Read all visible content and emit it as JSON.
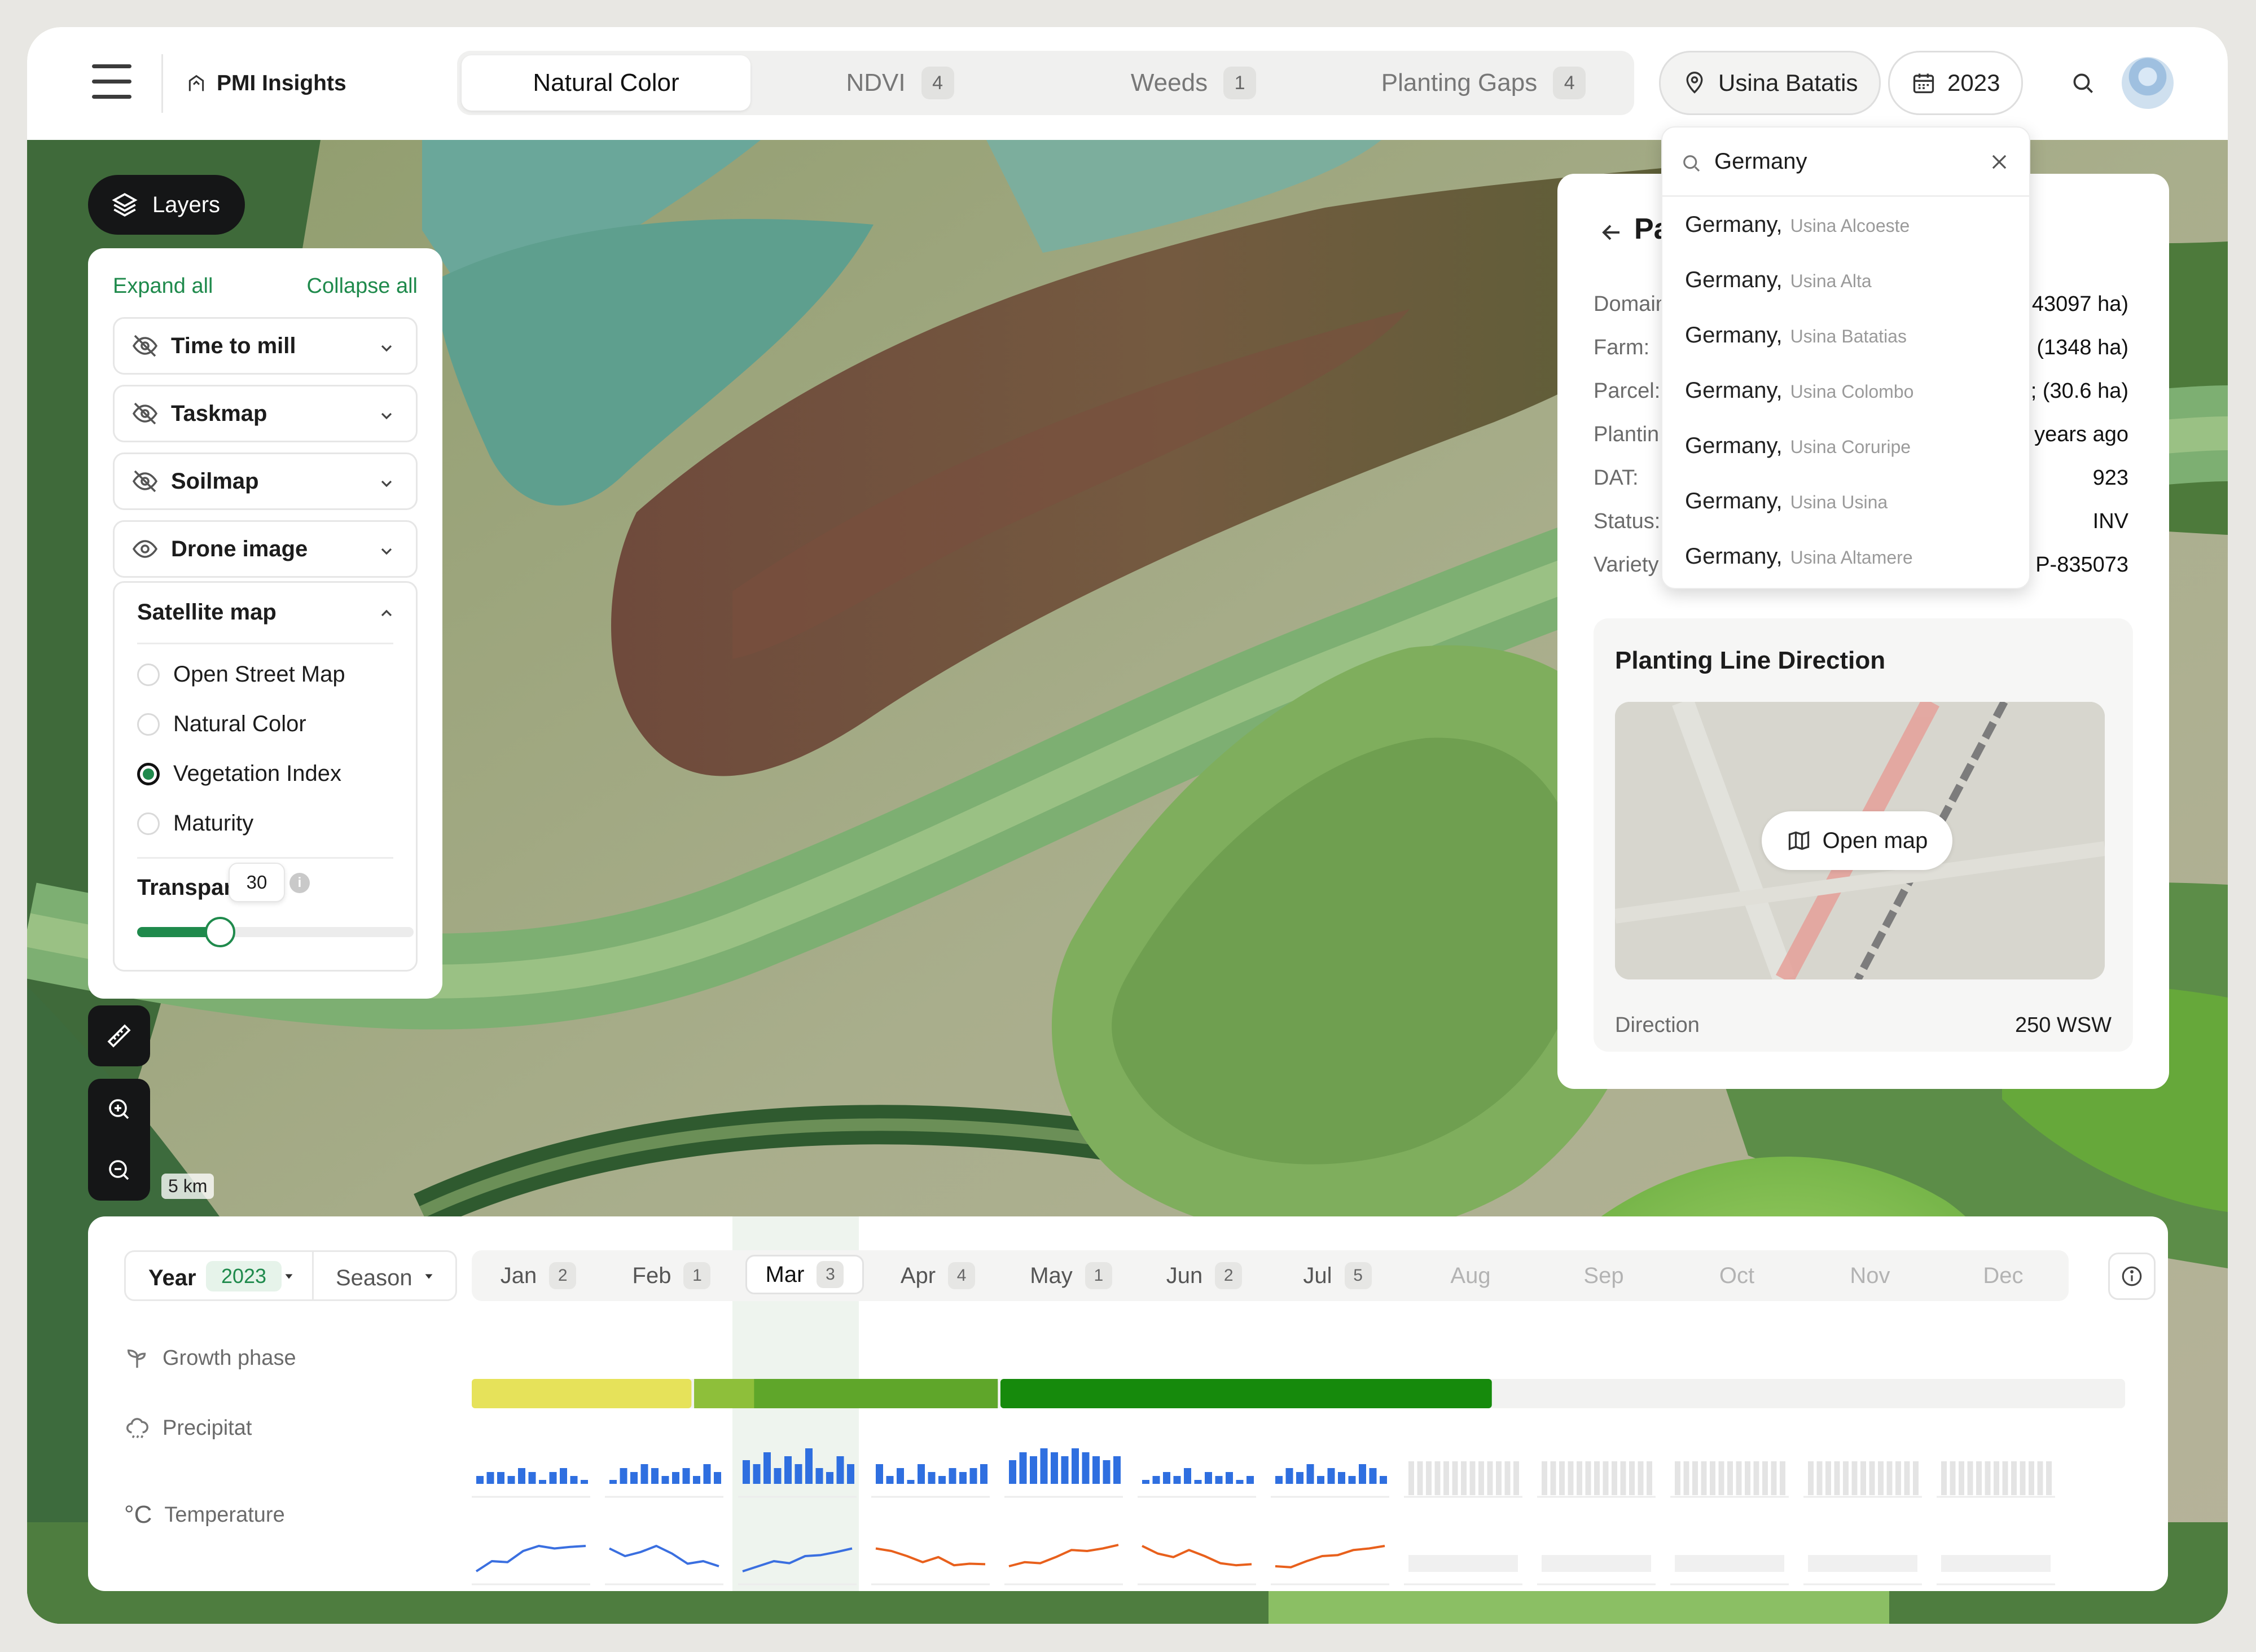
{
  "app": {
    "name": "PMI Insights"
  },
  "tabs": [
    {
      "label": "Natural Color",
      "count": ""
    },
    {
      "label": "NDVI",
      "count": "4"
    },
    {
      "label": "Weeds",
      "count": "1"
    },
    {
      "label": "Planting Gaps",
      "count": "4"
    }
  ],
  "location": {
    "label": "Usina Batatis"
  },
  "year_picker": {
    "label": "2023"
  },
  "layers": {
    "button_label": "Layers",
    "expand_all": "Expand all",
    "collapse_all": "Collapse all",
    "items": [
      {
        "label": "Time to mill",
        "icon": "eye-off-icon"
      },
      {
        "label": "Taskmap",
        "icon": "eye-off-icon"
      },
      {
        "label": "Soilmap",
        "icon": "eye-off-icon"
      },
      {
        "label": "Drone image",
        "icon": "eye-icon"
      }
    ],
    "satellite": {
      "title": "Satellite map",
      "options": [
        "Open Street Map",
        "Natural Color",
        "Vegetation Index",
        "Maturity"
      ],
      "selected": "Vegetation Index",
      "transparency_label": "Transparency",
      "transparency_value": "30",
      "transparency_fraction": 0.3
    }
  },
  "scale": "5 km",
  "search": {
    "value": "Germany",
    "results": [
      {
        "country": "Germany,",
        "site": "Usina Alcoeste"
      },
      {
        "country": "Germany,",
        "site": "Usina Alta"
      },
      {
        "country": "Germany,",
        "site": "Usina Batatias"
      },
      {
        "country": "Germany,",
        "site": "Usina Colombo"
      },
      {
        "country": "Germany,",
        "site": "Usina Coruripe"
      },
      {
        "country": "Germany,",
        "site": "Usina Usina"
      },
      {
        "country": "Germany,",
        "site": "Usina Altamere"
      }
    ]
  },
  "parcel": {
    "title": "Pa",
    "rows": [
      {
        "key": "Domain",
        "value": "43097 ha)"
      },
      {
        "key": "Farm:",
        "value": "(1348 ha)"
      },
      {
        "key": "Parcel:",
        "value": "; (30.6 ha)"
      },
      {
        "key": "Plantin",
        "value": "years ago"
      },
      {
        "key": "DAT:",
        "value": "923"
      },
      {
        "key": "Status:",
        "value": "INV"
      },
      {
        "key": "Variety",
        "value": "P-835073"
      }
    ],
    "planting": {
      "title": "Planting Line Direction",
      "open_map": "Open map",
      "direction_label": "Direction",
      "direction_value": "250 WSW"
    }
  },
  "timeline": {
    "year_label": "Year",
    "year_value": "2023",
    "season_label": "Season",
    "months": [
      {
        "label": "Jan",
        "count": "2"
      },
      {
        "label": "Feb",
        "count": "1"
      },
      {
        "label": "Mar",
        "count": "3"
      },
      {
        "label": "Apr",
        "count": "4"
      },
      {
        "label": "May",
        "count": "1"
      },
      {
        "label": "Jun",
        "count": "2"
      },
      {
        "label": "Jul",
        "count": "5"
      },
      {
        "label": "Aug",
        "count": ""
      },
      {
        "label": "Sep",
        "count": ""
      },
      {
        "label": "Oct",
        "count": ""
      },
      {
        "label": "Nov",
        "count": ""
      },
      {
        "label": "Dec",
        "count": ""
      }
    ],
    "selected_month": "Mar",
    "rows": {
      "growth": "Growth phase",
      "precip": "Precipitat",
      "temp": "Temperature"
    }
  },
  "colors": {
    "accent": "#1f8a4c",
    "growth_phases": [
      "#e6e25a",
      "#9cc43c",
      "#5fa62a",
      "#168a0c"
    ],
    "precip_bar": "#2f6fe0",
    "temp_cool": "#3a6fe0",
    "temp_warm": "#e8601c"
  }
}
